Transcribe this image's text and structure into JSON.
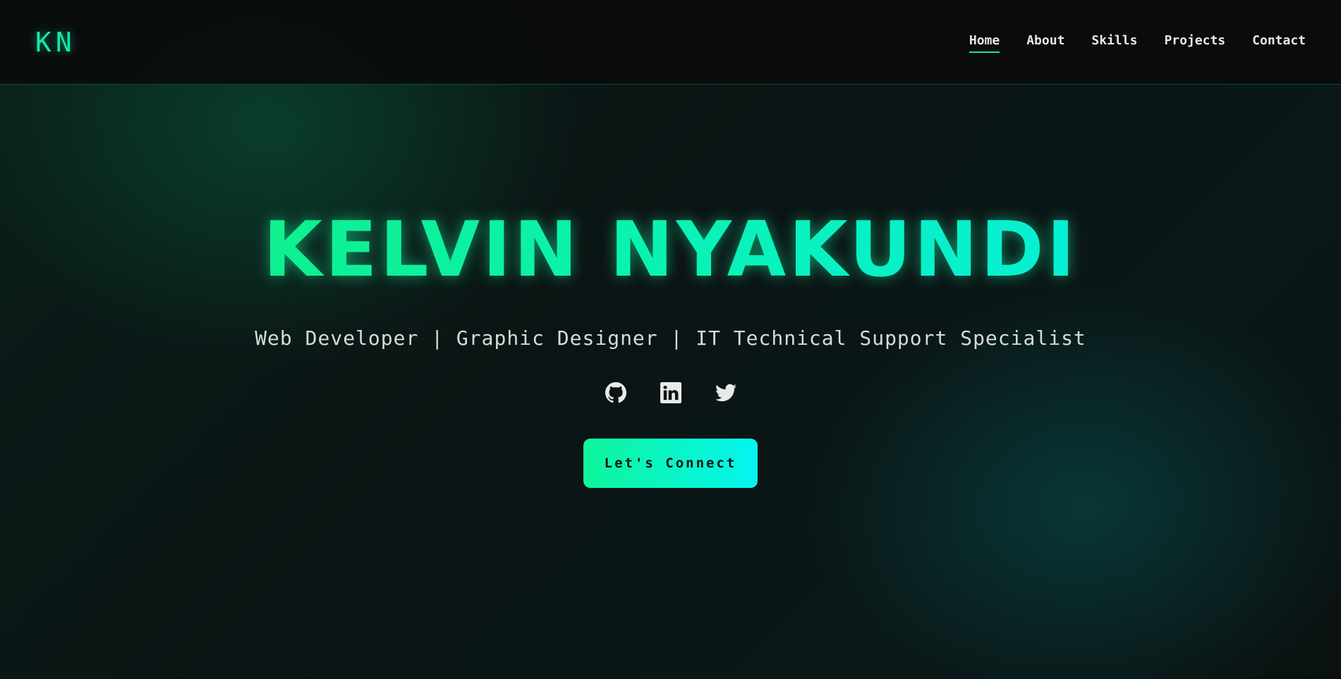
{
  "header": {
    "logo": "KN",
    "nav": [
      {
        "label": "Home",
        "active": true
      },
      {
        "label": "About",
        "active": false
      },
      {
        "label": "Skills",
        "active": false
      },
      {
        "label": "Projects",
        "active": false
      },
      {
        "label": "Contact",
        "active": false
      }
    ]
  },
  "hero": {
    "name": "KELVIN NYAKUNDI",
    "subtitle": "Web Developer | Graphic Designer | IT Technical Support Specialist",
    "socials": [
      {
        "icon": "github-icon"
      },
      {
        "icon": "linkedin-icon"
      },
      {
        "icon": "twitter-icon"
      }
    ],
    "cta_label": "Let's Connect"
  },
  "colors": {
    "accent": "#13e8a8",
    "accent_cyan": "#04f5f0",
    "background": "#0b1414",
    "text": "#e6e8e8"
  }
}
